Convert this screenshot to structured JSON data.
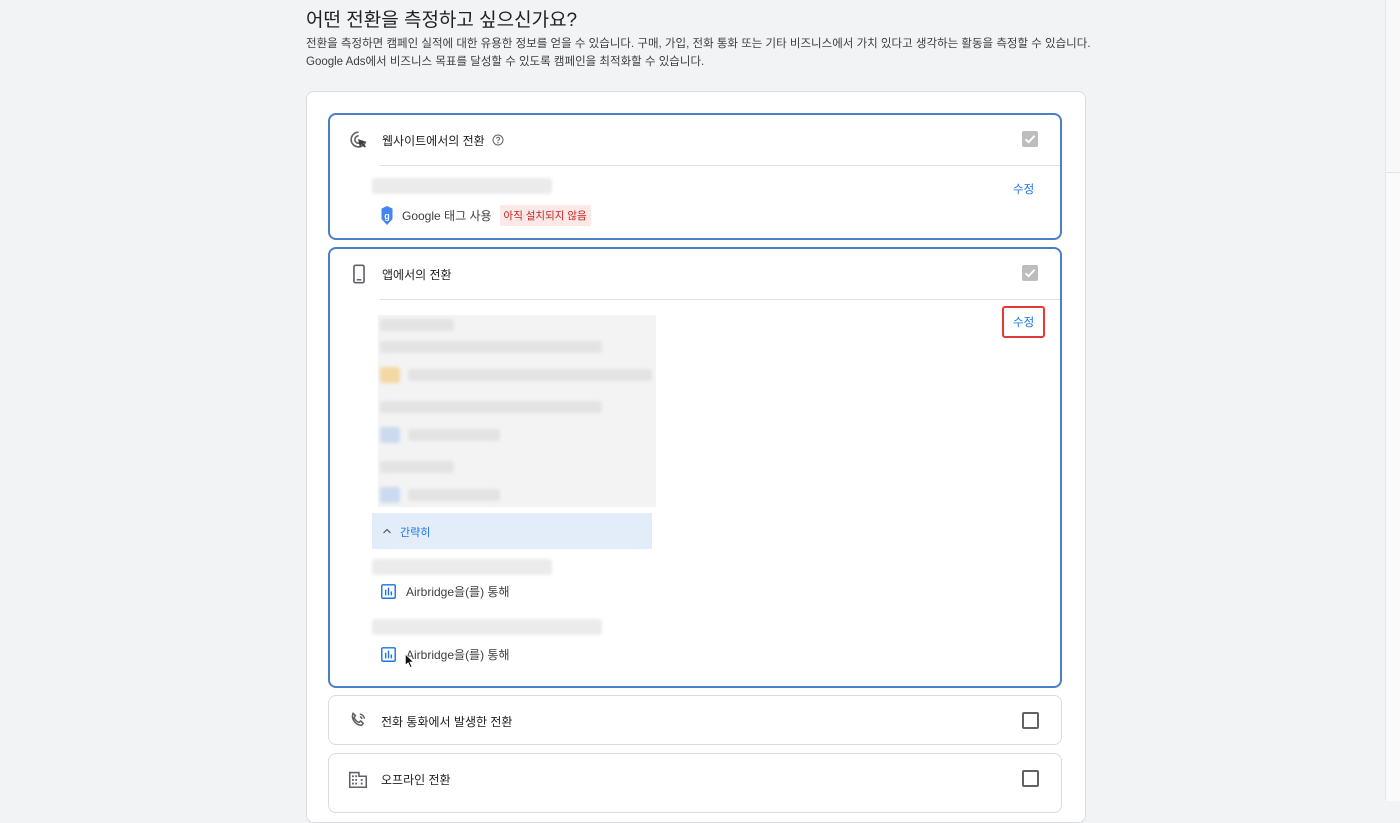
{
  "page": {
    "title": "어떤 전환을 측정하고 싶으신가요?",
    "description": "전환을 측정하면 캠페인 실적에 대한 유용한 정보를 얻을 수 있습니다. 구매, 가입, 전화 통화 또는 기타 비즈니스에서 가치 있다고 생각하는 활동을 측정할 수 있습니다. Google Ads에서 비즈니스 목표를 달성할 수 있도록 캠페인을 최적화할 수 있습니다."
  },
  "options": {
    "website": {
      "title": "웹사이트에서의 전환",
      "icon": "cursor-click-icon",
      "checked": true,
      "edit_label": "수정",
      "tag_label": "Google 태그 사용",
      "tag_status": "아직 설치되지 않음"
    },
    "app": {
      "title": "앱에서의 전환",
      "icon": "smartphone-icon",
      "checked": true,
      "edit_label": "수정",
      "collapse_label": "간략히",
      "via_1": "Airbridge을(를) 통해",
      "via_2": "Airbridge을(를) 통해"
    },
    "phone": {
      "title": "전화 통화에서 발생한 전환",
      "icon": "phone-call-icon",
      "checked": false
    },
    "offline": {
      "title": "오프라인 전환",
      "icon": "building-icon",
      "checked": false
    }
  },
  "colors": {
    "accent": "#1a73e8",
    "selected_border": "#4a7fc6",
    "highlight_border": "#e53935",
    "warning_bg": "#fce8e6",
    "warning_text": "#c5221f"
  }
}
